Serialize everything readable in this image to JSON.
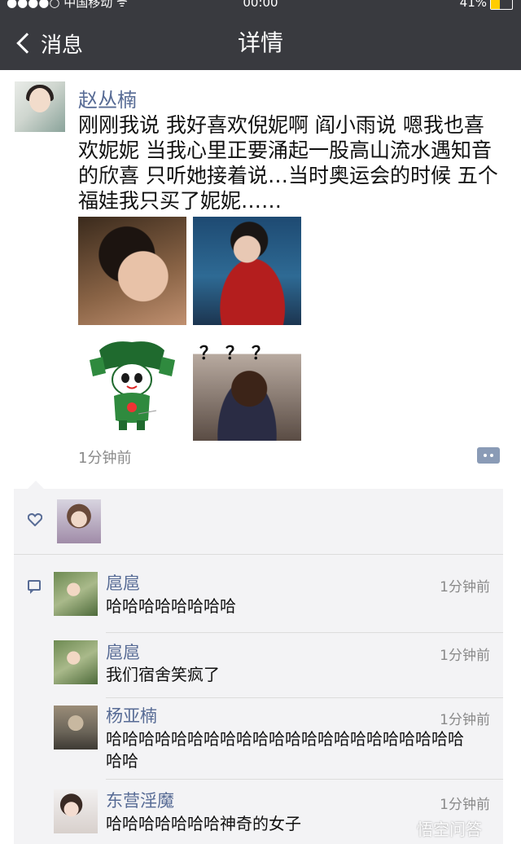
{
  "status_bar": {
    "carrier": "●●●●○ 中国移动 ᯤ",
    "time": "00:00",
    "battery": "41%",
    "battery_level": 0.41
  },
  "nav": {
    "back_label": "消息",
    "title": "详情"
  },
  "post": {
    "author": "赵丛楠",
    "text": "刚刚我说 我好喜欢倪妮啊 阎小雨说 嗯我也喜欢妮妮 当我心里正要涌起一股高山流水遇知音的欣喜 只听她接着说…当时奥运会的时候 五个福娃我只买了妮妮……",
    "photo_caption": "？？？",
    "time": "1分钟前"
  },
  "comments": [
    {
      "name": "扈扈",
      "time": "1分钟前",
      "text": "哈哈哈哈哈哈哈哈"
    },
    {
      "name": "扈扈",
      "time": "1分钟前",
      "text": "我们宿舍笑疯了"
    },
    {
      "name": "杨亚楠",
      "time": "1分钟前",
      "text": "哈哈哈哈哈哈哈哈哈哈哈哈哈哈哈哈哈哈哈哈哈哈哈哈"
    },
    {
      "name": "东营淫魔",
      "time": "1分钟前",
      "text": "哈哈哈哈哈哈哈神奇的女子"
    }
  ],
  "watermark": "悟空问答",
  "colors": {
    "nav_bg": "#393a3f",
    "link_blue": "#576b95",
    "interact_bg": "#f3f3f5"
  }
}
